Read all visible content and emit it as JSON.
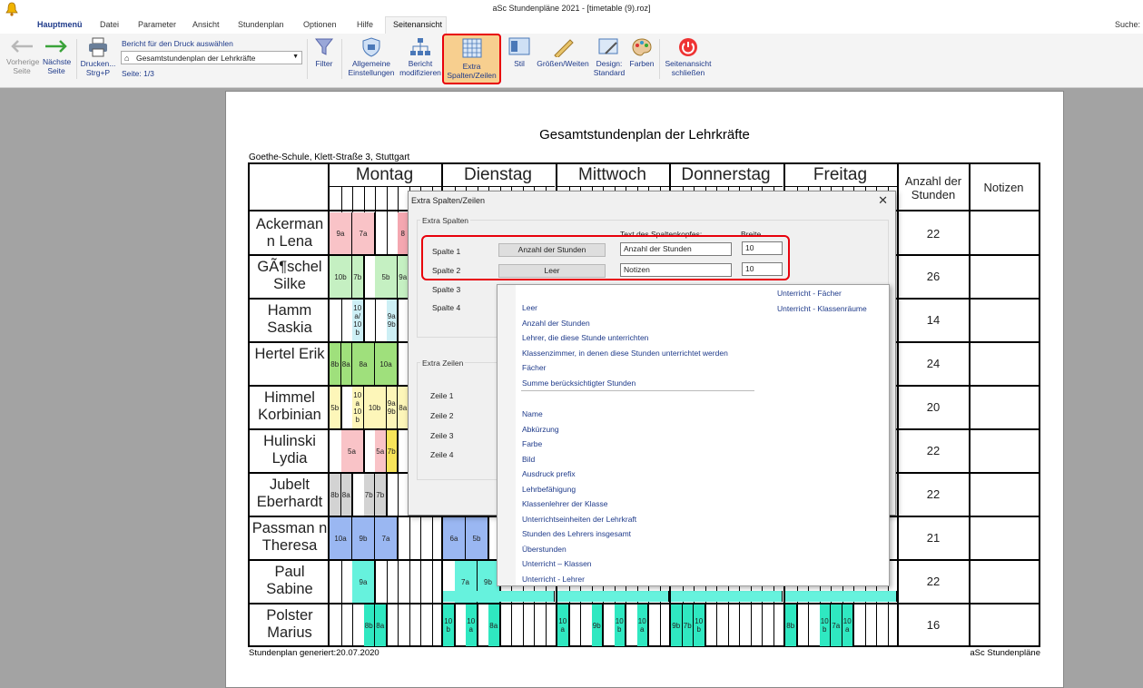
{
  "window": {
    "title": "aSc Stundenpläne 2021  - [timetable (9).roz]",
    "search_label": "Suche:"
  },
  "menu": [
    "Hauptmenü",
    "Datei",
    "Parameter",
    "Ansicht",
    "Stundenplan",
    "Optionen",
    "Hilfe",
    "Seitenansicht"
  ],
  "ribbon": {
    "prev": "Vorherige Seite",
    "next": "Nächste Seite",
    "print": "Drucken...",
    "print_shortcut": "Strg+P",
    "report_label": "Bericht für den Druck auswählen",
    "report_value": "Gesamtstundenplan der Lehrkräfte",
    "page": "Seite: 1/3",
    "filter": "Filter",
    "general": "Allgemeine Einstellungen",
    "modify": "Bericht modifizieren",
    "extra": "Extra Spalten/Zeilen",
    "style": "Stil",
    "sizes": "Größen/Weiten",
    "design": "Design: Standard",
    "colors": "Farben",
    "close": "Seitenansicht schließen"
  },
  "report": {
    "title": "Gesamtstundenplan der Lehrkräfte",
    "school": "Goethe-Schule, Klett-Straße 3, Stuttgart",
    "days": [
      "Montag",
      "Dienstag",
      "Mittwoch",
      "Donnerstag",
      "Freitag"
    ],
    "col_count": "Anzahl der Stunden",
    "col_notes": "Notizen",
    "teachers": [
      {
        "name": "Ackerman n Lena",
        "count": "22"
      },
      {
        "name": "GÃ¶schel Silke",
        "count": "26"
      },
      {
        "name": "Hamm Saskia",
        "count": "14"
      },
      {
        "name": "Hertel Erik",
        "count": "24"
      },
      {
        "name": "Himmel Korbinian",
        "count": "20"
      },
      {
        "name": "Hulinski Lydia",
        "count": "22"
      },
      {
        "name": "Jubelt Eberhardt",
        "count": "22"
      },
      {
        "name": "Passman n Theresa",
        "count": "21"
      },
      {
        "name": "Paul Sabine",
        "count": "22"
      },
      {
        "name": "Polster Marius",
        "count": "16"
      }
    ],
    "footer_left": "Stundenplan generiert:20.07.2020",
    "footer_right": "aSc Stundenpläne"
  },
  "cells": [
    "9a",
    "7a",
    "8",
    "10b",
    "7b",
    "5b",
    "9a",
    "10 a/ 10 b",
    "9a 9b",
    "8b",
    "8a",
    "8a",
    "10a",
    "5b",
    "10 a 10 b",
    "10b",
    "9a 9b",
    "8a",
    "5a",
    "5a",
    "7b",
    "8b",
    "8a",
    "7b",
    "7b",
    "10a",
    "9b",
    "7a",
    "9a",
    "8b",
    "8a",
    "6a",
    "5b",
    "7a",
    "9b",
    "10 b",
    "10 a",
    "8a",
    "10 a",
    "9b",
    "10 b",
    "10 a",
    "9b",
    "7b",
    "10 b",
    "8b",
    "10 b",
    "7a",
    "10 a"
  ],
  "dialog": {
    "title": "Extra Spalten/Zeilen",
    "group_cols": "Extra Spalten",
    "hdr_text": "Text des Spaltenkopfes:",
    "hdr_width": "Breite",
    "col1": "Spalte 1",
    "col2": "Spalte 2",
    "col3": "Spalte 3",
    "col4": "Spalte 4",
    "col1_btn": "Anzahl der Stunden",
    "col2_btn": "Leer",
    "col1_text": "Anzahl der Stunden",
    "col2_text": "Notizen",
    "col1_w": "10",
    "col2_w": "10",
    "group_rows": "Extra Zeilen",
    "row1": "Zeile 1",
    "row2": "Zeile 2",
    "row3": "Zeile 3",
    "row4": "Zeile 4"
  },
  "dropdown": {
    "left_a": [
      "Leer",
      "Anzahl der Stunden",
      "Lehrer, die diese Stunde unterrichten",
      "Klassenzimmer, in denen diese Stunden unterrichtet werden",
      "Fächer",
      "Summe berücksichtigter Stunden"
    ],
    "left_b": [
      "Name",
      "Abkürzung",
      "Farbe",
      "Bild",
      "Ausdruck prefix",
      "Lehrbefähigung",
      "Klassenlehrer der Klasse",
      "Unterrichtseinheiten der Lehrkraft",
      "Stunden des Lehrers insgesamt",
      "Überstunden",
      "Unterricht – Klassen",
      "Unterricht - Lehrer"
    ],
    "right": [
      "Unterricht - Fächer",
      "Unterricht - Klassenräume"
    ]
  }
}
